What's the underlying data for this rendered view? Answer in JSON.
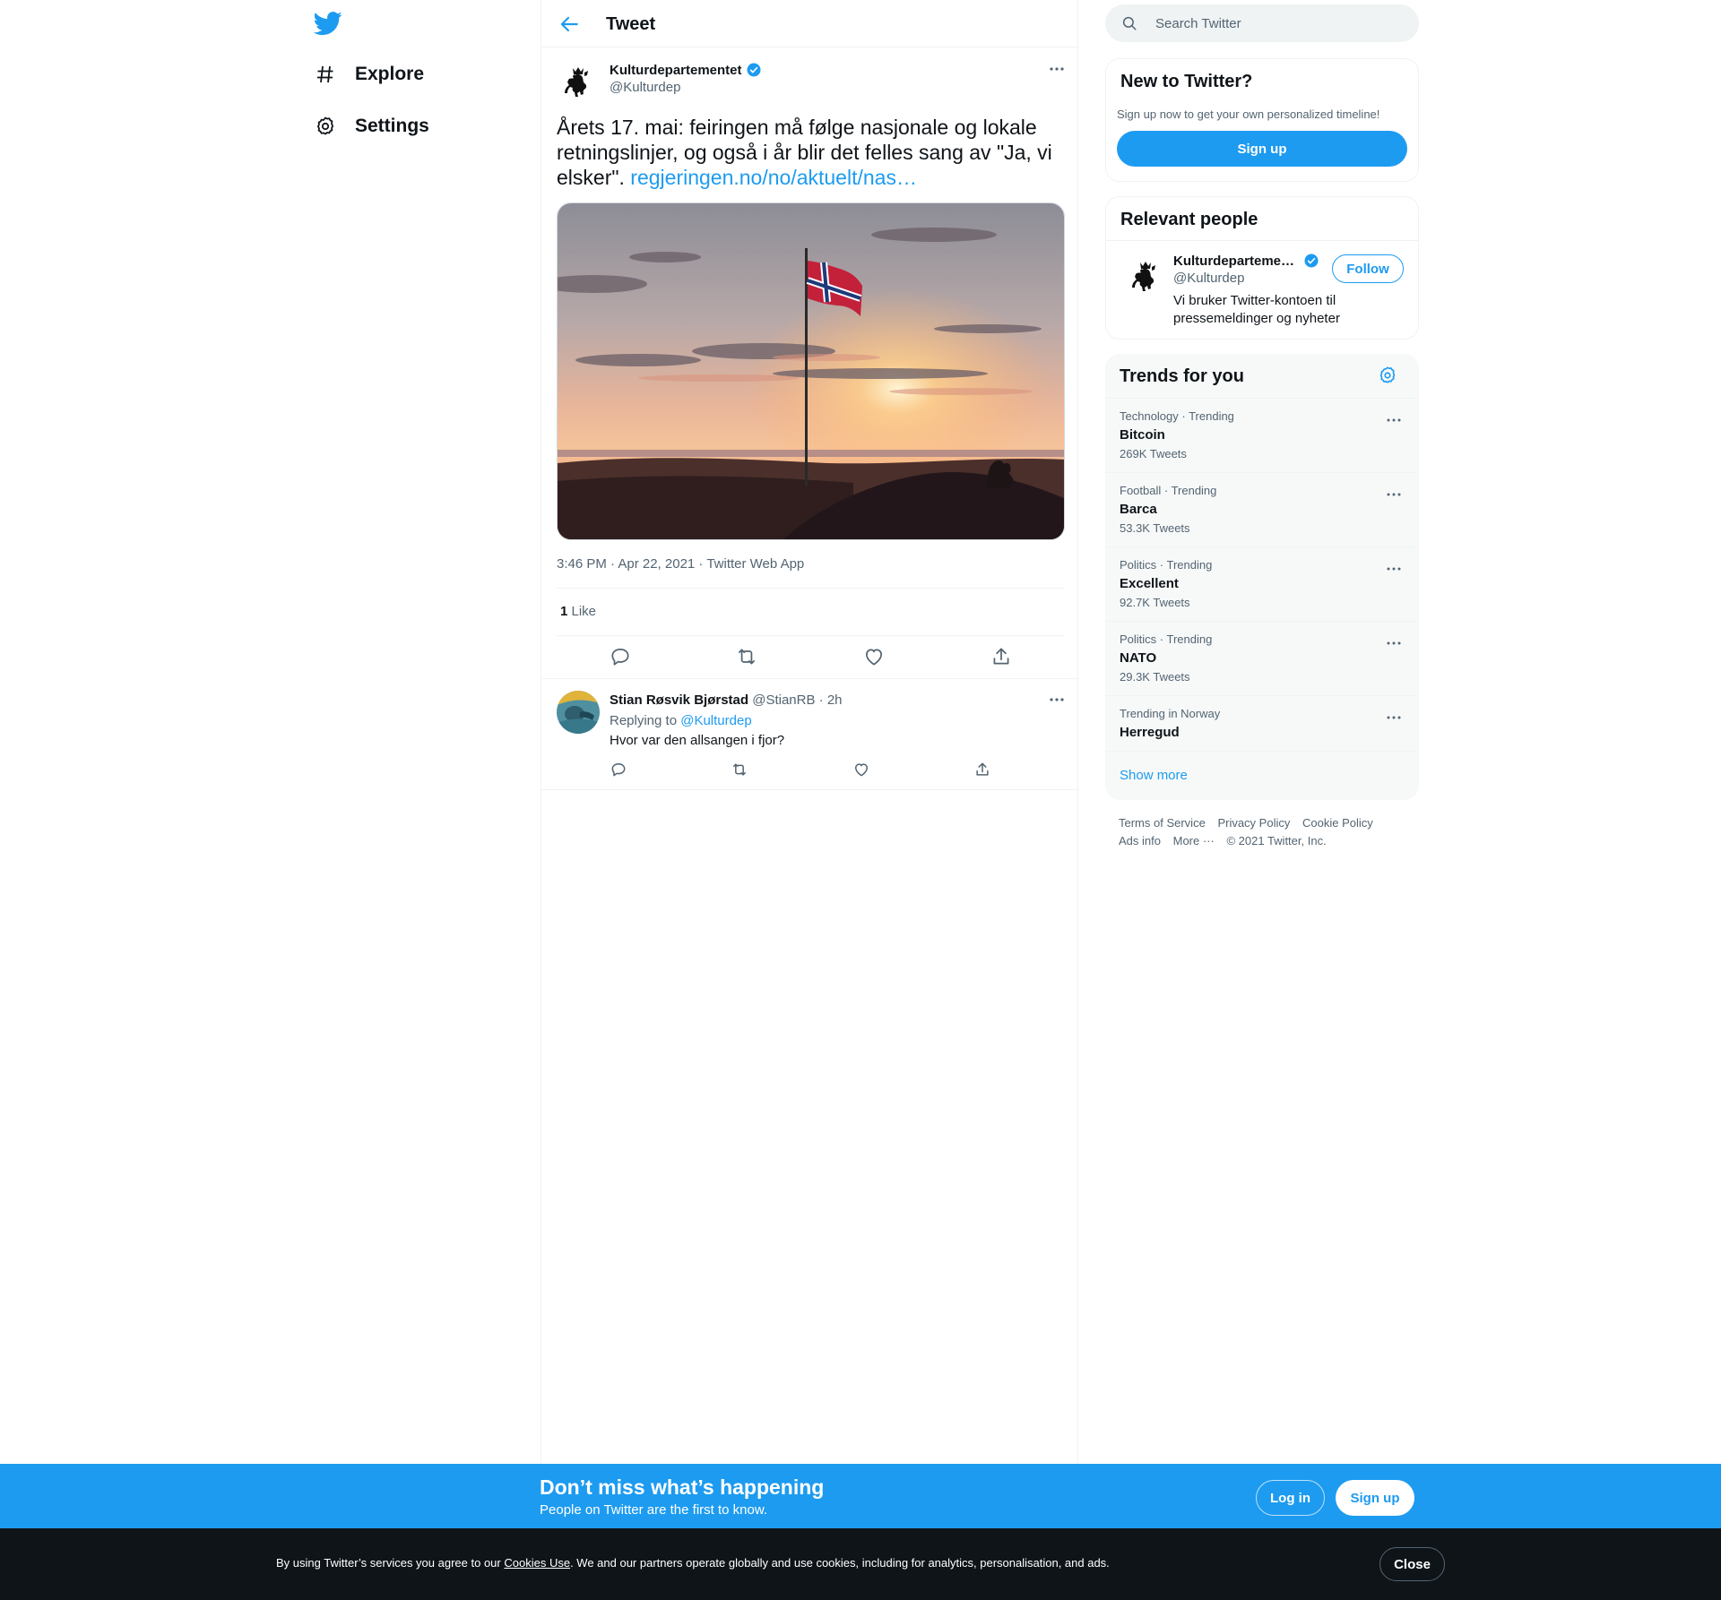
{
  "nav": {
    "logo": "twitter-bird-icon",
    "items": [
      {
        "label": "Explore",
        "icon": "hashtag-icon"
      },
      {
        "label": "Settings",
        "icon": "gear-icon"
      }
    ]
  },
  "header": {
    "title": "Tweet",
    "back_icon": "arrow-left-icon"
  },
  "tweet": {
    "author_name": "Kulturdepartementet",
    "author_handle": "@Kulturdep",
    "verified": true,
    "text": "Årets 17. mai: feiringen må følge nasjonale og lokale retningslinjer, og også i år blir det felles sang av \"Ja, vi elsker\". ",
    "link_text": "regjeringen.no/no/aktuelt/nas…",
    "media": "photo-norwegian-flag-sunset",
    "meta": "3:46 PM · Apr 22, 2021 · Twitter Web App",
    "like_count": "1",
    "like_label": " Like"
  },
  "reply": {
    "name": "Stian Røsvik Bjørstad",
    "handle": "@StianRB",
    "time": " · 2h",
    "replying_prefix": "Replying to ",
    "replying_to": "@Kulturdep",
    "text": "Hvor var den allsangen i fjor?"
  },
  "sidebar": {
    "search_placeholder": "Search Twitter",
    "new_to_twitter": {
      "title": "New to Twitter?",
      "subtitle": "Sign up now to get your own personalized timeline!",
      "signup_label": "Sign up"
    },
    "relevant_people": {
      "title": "Relevant people",
      "name": "Kulturdeparteme…",
      "handle": "@Kulturdep",
      "bio": "Vi bruker Twitter-kontoen til pressemeldinger og nyheter",
      "follow_label": "Follow"
    },
    "trends": {
      "title": "Trends for you",
      "items": [
        {
          "category": "Technology · Trending",
          "name": "Bitcoin",
          "count": "269K Tweets"
        },
        {
          "category": "Football · Trending",
          "name": "Barca",
          "count": "53.3K Tweets"
        },
        {
          "category": "Politics · Trending",
          "name": "Excellent",
          "count": "92.7K Tweets"
        },
        {
          "category": "Politics · Trending",
          "name": "NATO",
          "count": "29.3K Tweets"
        },
        {
          "category": "Trending in Norway",
          "name": "Herregud",
          "count": ""
        }
      ],
      "show_more": "Show more"
    },
    "footer": {
      "terms": "Terms of Service",
      "privacy": "Privacy Policy",
      "cookie": "Cookie Policy",
      "ads": "Ads info",
      "more": "More ···",
      "copyright": "© 2021 Twitter, Inc."
    }
  },
  "banner": {
    "headline": "Don’t miss what’s happening",
    "sub": "People on Twitter are the first to know.",
    "login_label": "Log in",
    "signup_label": "Sign up"
  },
  "cookie_bar": {
    "prefix": "By using Twitter’s services you agree to our ",
    "link": "Cookies Use",
    "suffix": ". We and our partners operate globally and use cookies, including for analytics, personalisation, and ads.",
    "close_label": "Close"
  },
  "colors": {
    "accent": "#1d9bf0",
    "text": "#0f1419",
    "muted": "#536471",
    "dark": "#0f1419"
  }
}
